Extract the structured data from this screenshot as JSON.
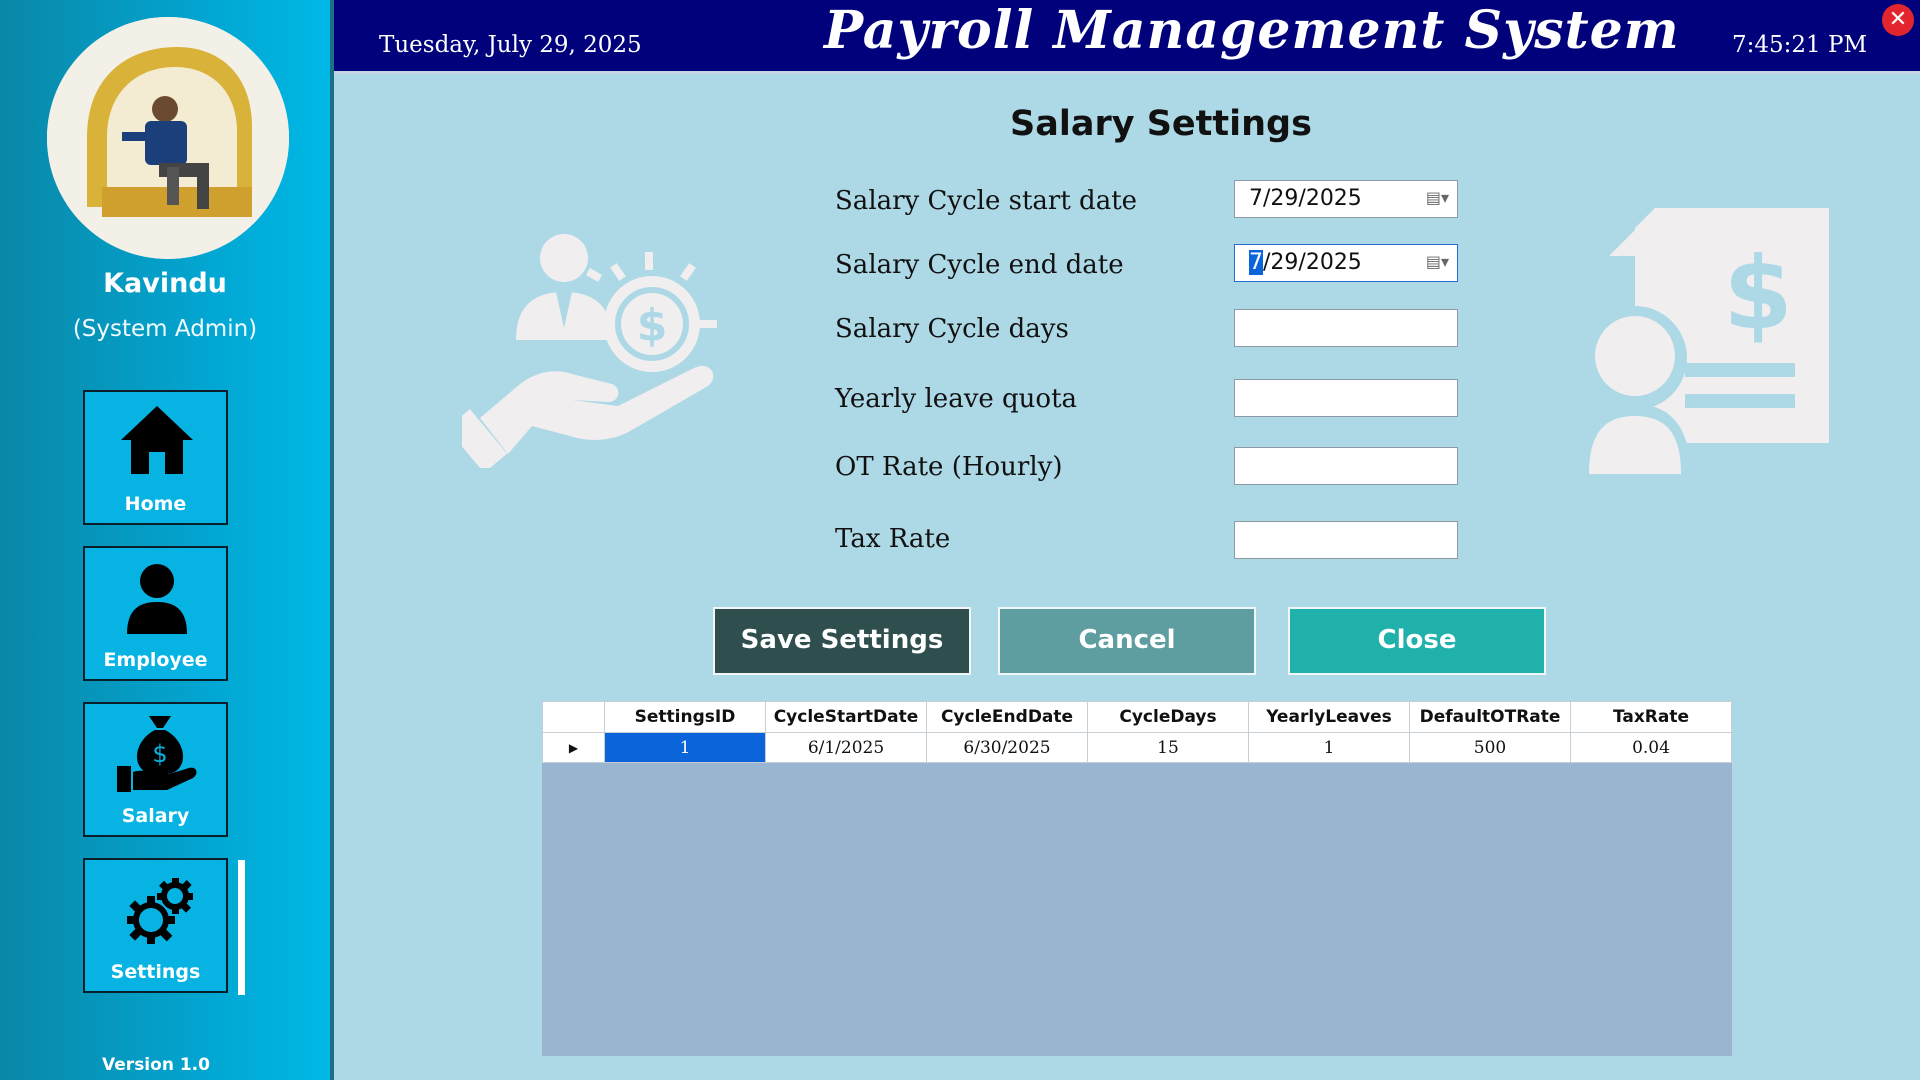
{
  "sidebar": {
    "user_name": "Kavindu",
    "user_role": "(System Admin)",
    "nav": [
      {
        "label": "Home",
        "icon": "home-icon"
      },
      {
        "label": "Employee",
        "icon": "person-icon"
      },
      {
        "label": "Salary",
        "icon": "money-bag-hand-icon"
      },
      {
        "label": "Settings",
        "icon": "gears-icon"
      }
    ],
    "active": "Settings",
    "version": "Version 1.0"
  },
  "header": {
    "date": "Tuesday, July 29, 2025",
    "title": "Payroll Management System",
    "time": "7:45:21 PM",
    "close_symbol": "✕"
  },
  "form": {
    "title": "Salary Settings",
    "start_date_label": "Salary Cycle start date",
    "start_date_value": "7/29/2025",
    "end_date_label": "Salary Cycle end date",
    "end_date_selected": "7",
    "end_date_rest": "/29/2025",
    "cycle_days_label": "Salary Cycle days",
    "cycle_days_value": "",
    "leave_quota_label": "Yearly leave quota",
    "leave_quota_value": "",
    "ot_rate_label": "OT Rate (Hourly)",
    "ot_rate_value": "",
    "tax_rate_label": "Tax Rate",
    "tax_rate_value": ""
  },
  "buttons": {
    "save": "Save Settings",
    "cancel": "Cancel",
    "close": "Close"
  },
  "table": {
    "columns": [
      "SettingsID",
      "CycleStartDate",
      "CycleEndDate",
      "CycleDays",
      "YearlyLeaves",
      "DefaultOTRate",
      "TaxRate"
    ],
    "rows": [
      [
        "1",
        "6/1/2025",
        "6/30/2025",
        "15",
        "1",
        "500",
        "0.04"
      ]
    ]
  },
  "colors": {
    "header_bg": "#01017b",
    "content_bg": "#add8e6",
    "save_button": "#2f4f4f",
    "cancel_button": "#5f9ea0",
    "close_button": "#20b2aa",
    "selection": "#0b64d9"
  }
}
